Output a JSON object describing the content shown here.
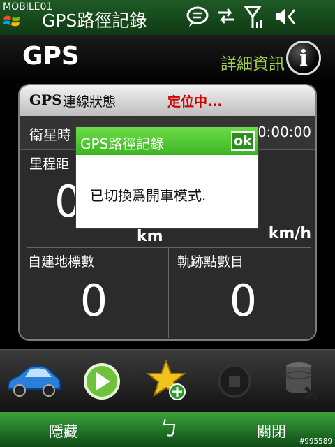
{
  "title_bar": {
    "watermark_logo": "MOBILE01",
    "app_title": "GPS路徑記錄",
    "icons": [
      "windows-logo-icon",
      "message-icon",
      "data-arrows-icon",
      "signal-icon",
      "speaker-muted-icon"
    ]
  },
  "header": {
    "title": "GPS",
    "detail_label": "詳細資訊",
    "info_glyph": "i"
  },
  "panel": {
    "status_gps": "GPS",
    "status_label": "連線狀態",
    "status_value": "定位中...",
    "sat_label": "衛星時",
    "sat_value": "0:00:00",
    "distance_label": "里程距",
    "distance_value": "0",
    "distance_unit": "km",
    "speed_unit": "km/h",
    "landmarks_label": "自建地標數",
    "landmarks_value": "0",
    "trackpoints_label": "軌跡點數目",
    "trackpoints_value": "0"
  },
  "dialog": {
    "title": "GPS路徑記錄",
    "ok_label": "ok",
    "message": "已切換爲開車模式."
  },
  "toolbar": {
    "icons": [
      "car-mode-icon",
      "play-icon",
      "add-landmark-star-icon",
      "stop-icon",
      "delete-database-icon"
    ]
  },
  "softkeys": {
    "left": "隱藏",
    "right": "關閉",
    "middle_glyph": "ㄅ"
  },
  "watermark": "#995589",
  "colors": {
    "title_green": "#1f5a26",
    "accent_green": "#9dd049",
    "status_red": "#d00000",
    "dialog_green": "#3cb523"
  }
}
